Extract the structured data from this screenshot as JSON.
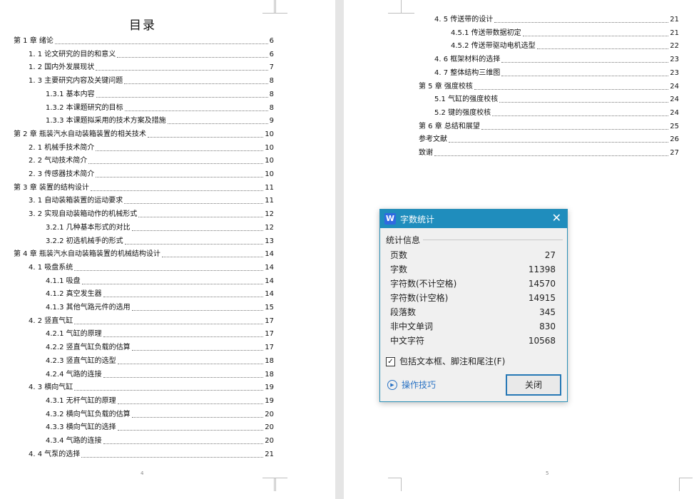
{
  "left_page": {
    "title": "目录",
    "page_number": "4",
    "entries": [
      {
        "text": "第 1 章  绪论",
        "page": "6"
      },
      {
        "text": "1. 1  论文研究的目的和意义",
        "page": "6"
      },
      {
        "text": "1. 2  国内外发展现状",
        "page": "7"
      },
      {
        "text": "1. 3  主要研究内容及关键问题",
        "page": "8"
      },
      {
        "text": "1.3.1  基本内容",
        "page": "8"
      },
      {
        "text": "1.3.2  本课题研究的目标",
        "page": "8"
      },
      {
        "text": "1.3.3  本课题拟采用的技术方案及措施",
        "page": "9"
      },
      {
        "text": "第 2 章  瓶装汽水自动装箱装置的相关技术",
        "page": "10"
      },
      {
        "text": "2. 1  机械手技术简介",
        "page": "10"
      },
      {
        "text": "2. 2  气动技术简介",
        "page": "10"
      },
      {
        "text": "2. 3  传感器技术简介",
        "page": "10"
      },
      {
        "text": "第 3 章  装置的结构设计",
        "page": "11"
      },
      {
        "text": "3. 1  自动装箱装置的运动要求",
        "page": "11"
      },
      {
        "text": "3. 2  实现自动装箱动作的机械形式",
        "page": "12"
      },
      {
        "text": "3.2.1  几种基本形式的对比",
        "page": "12"
      },
      {
        "text": "3.2.2  初选机械手的形式",
        "page": "13"
      },
      {
        "text": "第 4 章  瓶装汽水自动装箱装置的机械结构设计",
        "page": "14"
      },
      {
        "text": "4. 1  吸盘系统",
        "page": "14"
      },
      {
        "text": "4.1.1  吸盘",
        "page": "14"
      },
      {
        "text": "4.1.2  真空发生器",
        "page": "14"
      },
      {
        "text": "4.1.3  其他气路元件的选用",
        "page": "15"
      },
      {
        "text": "4. 2  竖直气缸",
        "page": "17"
      },
      {
        "text": "4.2.1  气缸的原理",
        "page": "17"
      },
      {
        "text": "4.2.2  竖直气缸负载的估算",
        "page": "17"
      },
      {
        "text": "4.2.3  竖直气缸的选型",
        "page": "18"
      },
      {
        "text": "4.2.4  气路的连接",
        "page": "18"
      },
      {
        "text": "4. 3  横向气缸",
        "page": "19"
      },
      {
        "text": "4.3.1  无杆气缸的原理",
        "page": "19"
      },
      {
        "text": "4.3.2  横向气缸负载的估算",
        "page": "20"
      },
      {
        "text": "4.3.3  横向气缸的选择",
        "page": "20"
      },
      {
        "text": "4.3.4  气路的连接",
        "page": "20"
      },
      {
        "text": "4. 4  气泵的选择",
        "page": "21"
      }
    ]
  },
  "right_page": {
    "page_number": "5",
    "entries": [
      {
        "text": "4. 5  传送带的设计",
        "page": "21"
      },
      {
        "text": "4.5.1  传送带数据初定",
        "page": "21"
      },
      {
        "text": "4.5.2  传送带驱动电机选型",
        "page": "22"
      },
      {
        "text": "4. 6  框架材料的选择",
        "page": "23"
      },
      {
        "text": "4. 7  整体结构三维图",
        "page": "23"
      },
      {
        "text": "第 5 章  强度校核",
        "page": "24"
      },
      {
        "text": "5.1  气缸的强度校核",
        "page": "24"
      },
      {
        "text": "5.2  键的强度校核",
        "page": "24"
      },
      {
        "text": "第 6 章  总结和展望",
        "page": "25"
      },
      {
        "text": "参考文献",
        "page": "26"
      },
      {
        "text": "致谢",
        "page": "27"
      }
    ]
  },
  "dialog": {
    "title": "字数统计",
    "app_icon": "W",
    "section_label": "统计信息",
    "stats": [
      {
        "label": "页数",
        "value": "27"
      },
      {
        "label": "字数",
        "value": "11398"
      },
      {
        "label": "字符数(不计空格)",
        "value": "14570"
      },
      {
        "label": "字符数(计空格)",
        "value": "14915"
      },
      {
        "label": "段落数",
        "value": "345"
      },
      {
        "label": "非中文单词",
        "value": "830"
      },
      {
        "label": "中文字符",
        "value": "10568"
      }
    ],
    "checkbox_label": "包括文本框、脚注和尾注(F)",
    "checkbox_checked": true,
    "tips_label": "操作技巧",
    "close_button": "关闭",
    "accent_color": "#1f8dbd"
  }
}
